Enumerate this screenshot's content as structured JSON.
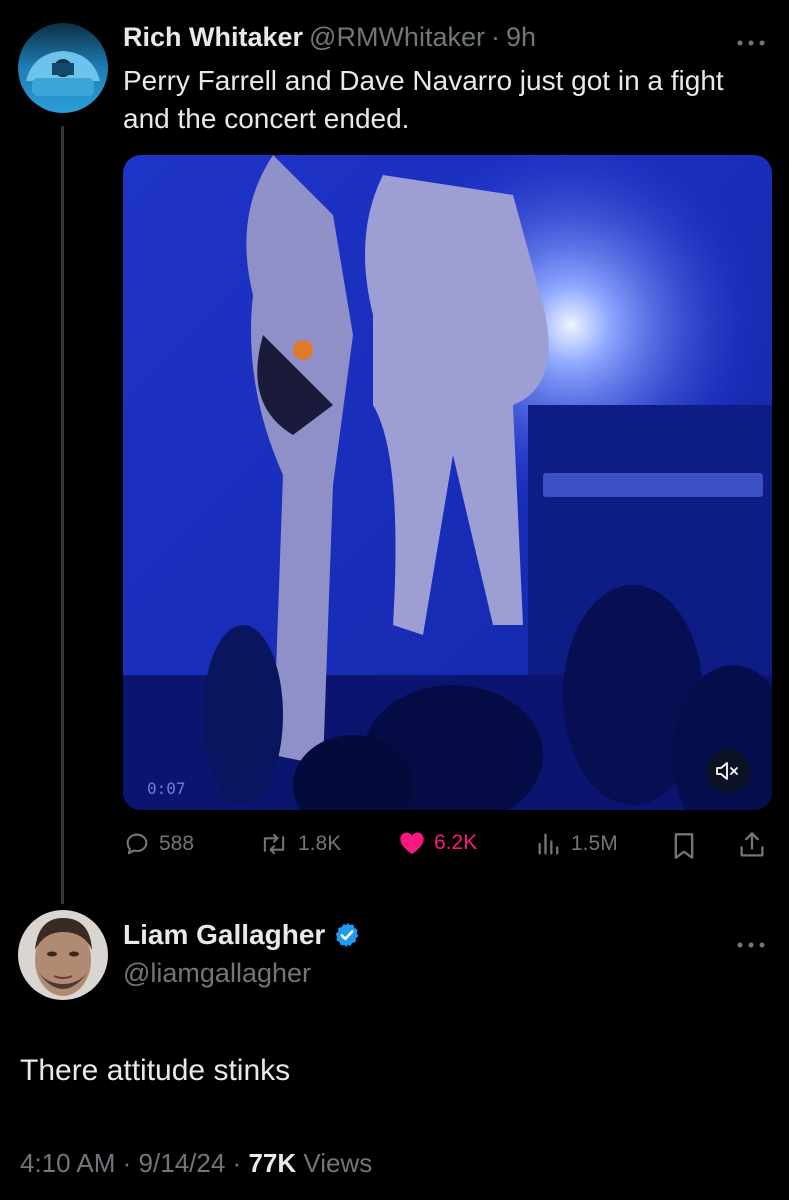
{
  "tweet1": {
    "author_name": "Rich Whitaker",
    "handle": "@RMWhitaker",
    "separator": "·",
    "time": "9h",
    "text_line1": "Perry Farrell and Dave Navarro just got in a fight",
    "text_line2": "and the concert ended.",
    "video": {
      "timestamp": "0:07",
      "muted": true
    },
    "actions": {
      "replies": "588",
      "reposts": "1.8K",
      "likes": "6.2K",
      "views": "1.5M",
      "liked": true
    }
  },
  "tweet2": {
    "author_name": "Liam Gallagher",
    "verified": true,
    "handle": "@liamgallagher",
    "text": "There attitude stinks",
    "time": "4:10 AM",
    "date": "9/14/24",
    "separator": "·",
    "views_count": "77K",
    "views_label": "Views"
  },
  "colors": {
    "background": "#000000",
    "like": "#f91880",
    "verified": "#1d9bf0",
    "muted_text": "#71767b"
  },
  "icons": [
    "more-icon",
    "reply-icon",
    "repost-icon",
    "heart-icon",
    "views-icon",
    "bookmark-icon",
    "share-icon",
    "mute-icon",
    "verified-icon"
  ]
}
